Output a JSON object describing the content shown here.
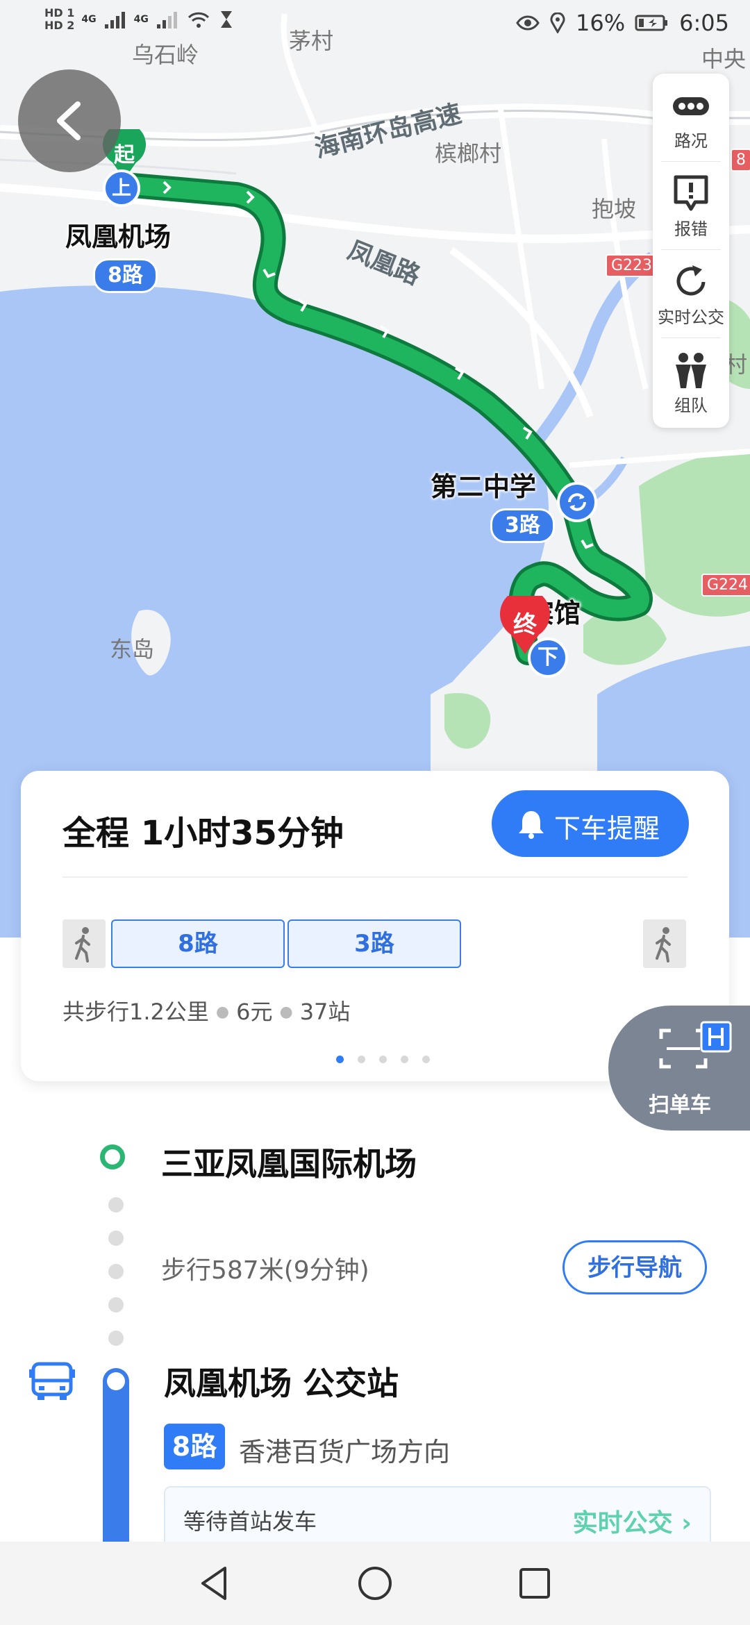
{
  "status_bar": {
    "sim1": "HD 1",
    "sim2": "HD 2",
    "net1": "4G",
    "net2": "4G",
    "battery": "16%",
    "time": "6:05"
  },
  "map": {
    "places": [
      "乌石岭",
      "茅村",
      "中央",
      "槟榔村",
      "抱坡",
      "东岛",
      "村"
    ],
    "roads": [
      "海南环岛高速",
      "凤凰路"
    ],
    "road_badges": [
      "G223",
      "G224",
      "8"
    ],
    "start_marker": "起",
    "end_marker": "终",
    "board_marker": "上",
    "alight_marker": "下",
    "stops": [
      {
        "name": "凤凰机场",
        "route": "8路"
      },
      {
        "name": "第二中学",
        "route": "3路"
      },
      {
        "name": "宾馆"
      }
    ]
  },
  "tools": [
    {
      "label": "路况",
      "icon": "traffic-icon"
    },
    {
      "label": "报错",
      "icon": "report-error-icon"
    },
    {
      "label": "实时公交",
      "icon": "refresh-icon"
    },
    {
      "label": "组队",
      "icon": "team-icon"
    }
  ],
  "summary": {
    "total": "全程  1小时35分钟",
    "alight_button": "下车提醒",
    "segments": [
      "8路",
      "3路"
    ],
    "walk": "共步行1.2公里",
    "fare": "6元",
    "stops": "37站",
    "page_count": 5,
    "page_current": 1
  },
  "scan_bike": {
    "label": "扫单车"
  },
  "itinerary": {
    "start": "三亚凤凰国际机场",
    "walk_info": "步行587米(9分钟)",
    "walk_nav": "步行导航",
    "bus_stop": "凤凰机场 公交站",
    "route": "8路",
    "direction": "香港百货广场方向",
    "wait": "等待首站发车",
    "realtime": "实时公交"
  },
  "colors": {
    "accent": "#2f7cf6",
    "route_green": "#1aa65a",
    "start_green": "#2bb673",
    "end_red": "#e8303b",
    "water": "#a9c6f7",
    "land_green": "#b5e3b5"
  }
}
